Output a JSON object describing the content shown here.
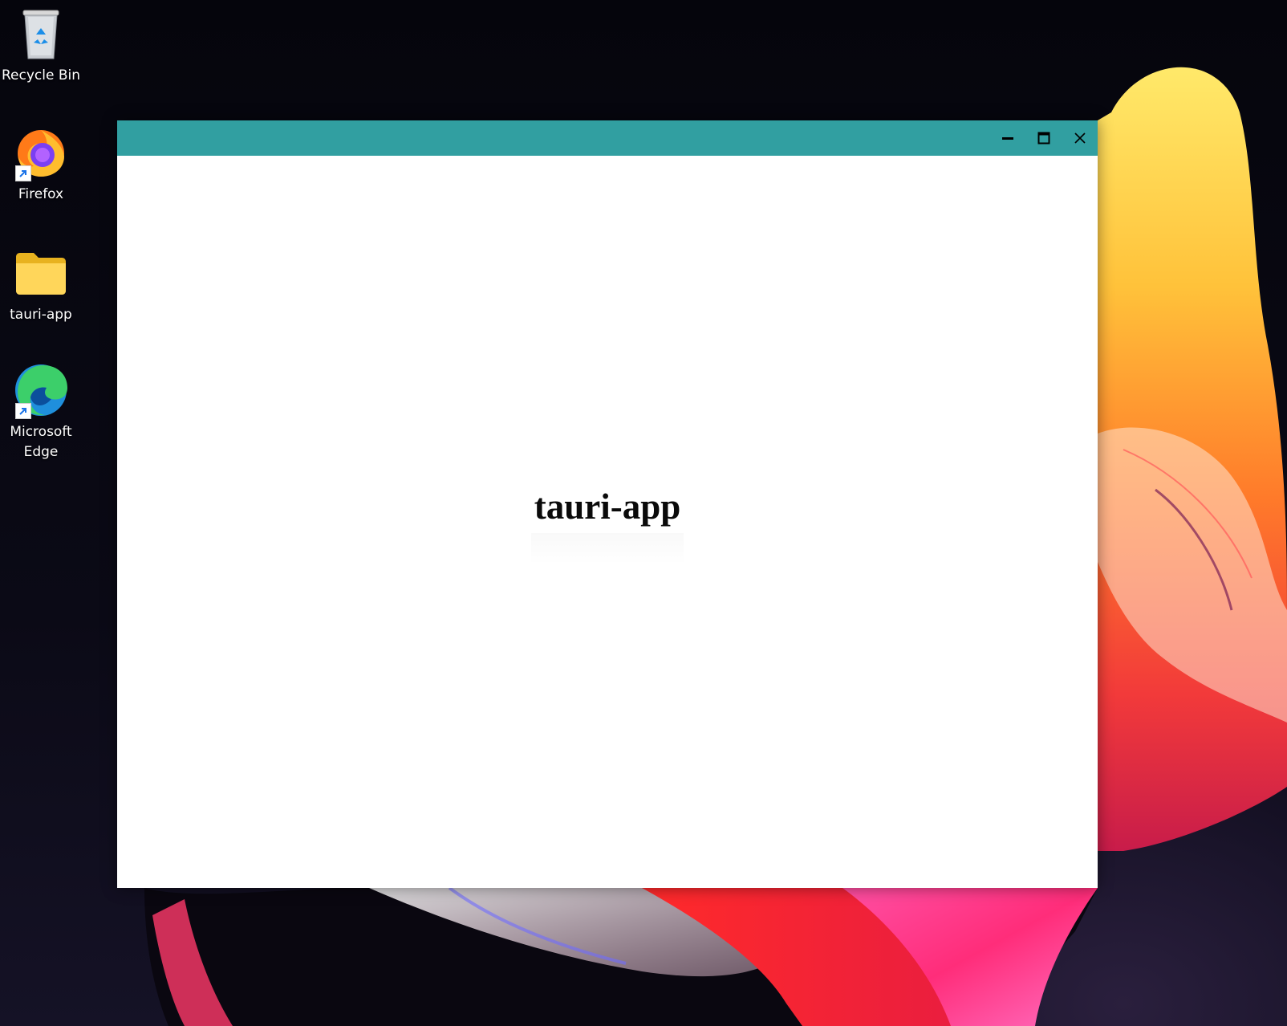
{
  "desktop": {
    "icons": [
      {
        "label": "Recycle Bin",
        "icon": "recycle-bin-icon"
      },
      {
        "label": "Firefox",
        "icon": "firefox-icon",
        "shortcut": true
      },
      {
        "label": "tauri-app",
        "icon": "folder-icon"
      },
      {
        "label": "Microsoft Edge",
        "icon": "edge-icon",
        "shortcut": true
      }
    ]
  },
  "window": {
    "titlebar_color": "#319fa1",
    "controls": [
      "minimize-icon",
      "maximize-icon",
      "close-icon"
    ],
    "heading": "tauri-app"
  },
  "colors": {
    "desktop_background": "#05050c",
    "window_background": "#ffffff",
    "heading_text": "#0a0a0a"
  }
}
